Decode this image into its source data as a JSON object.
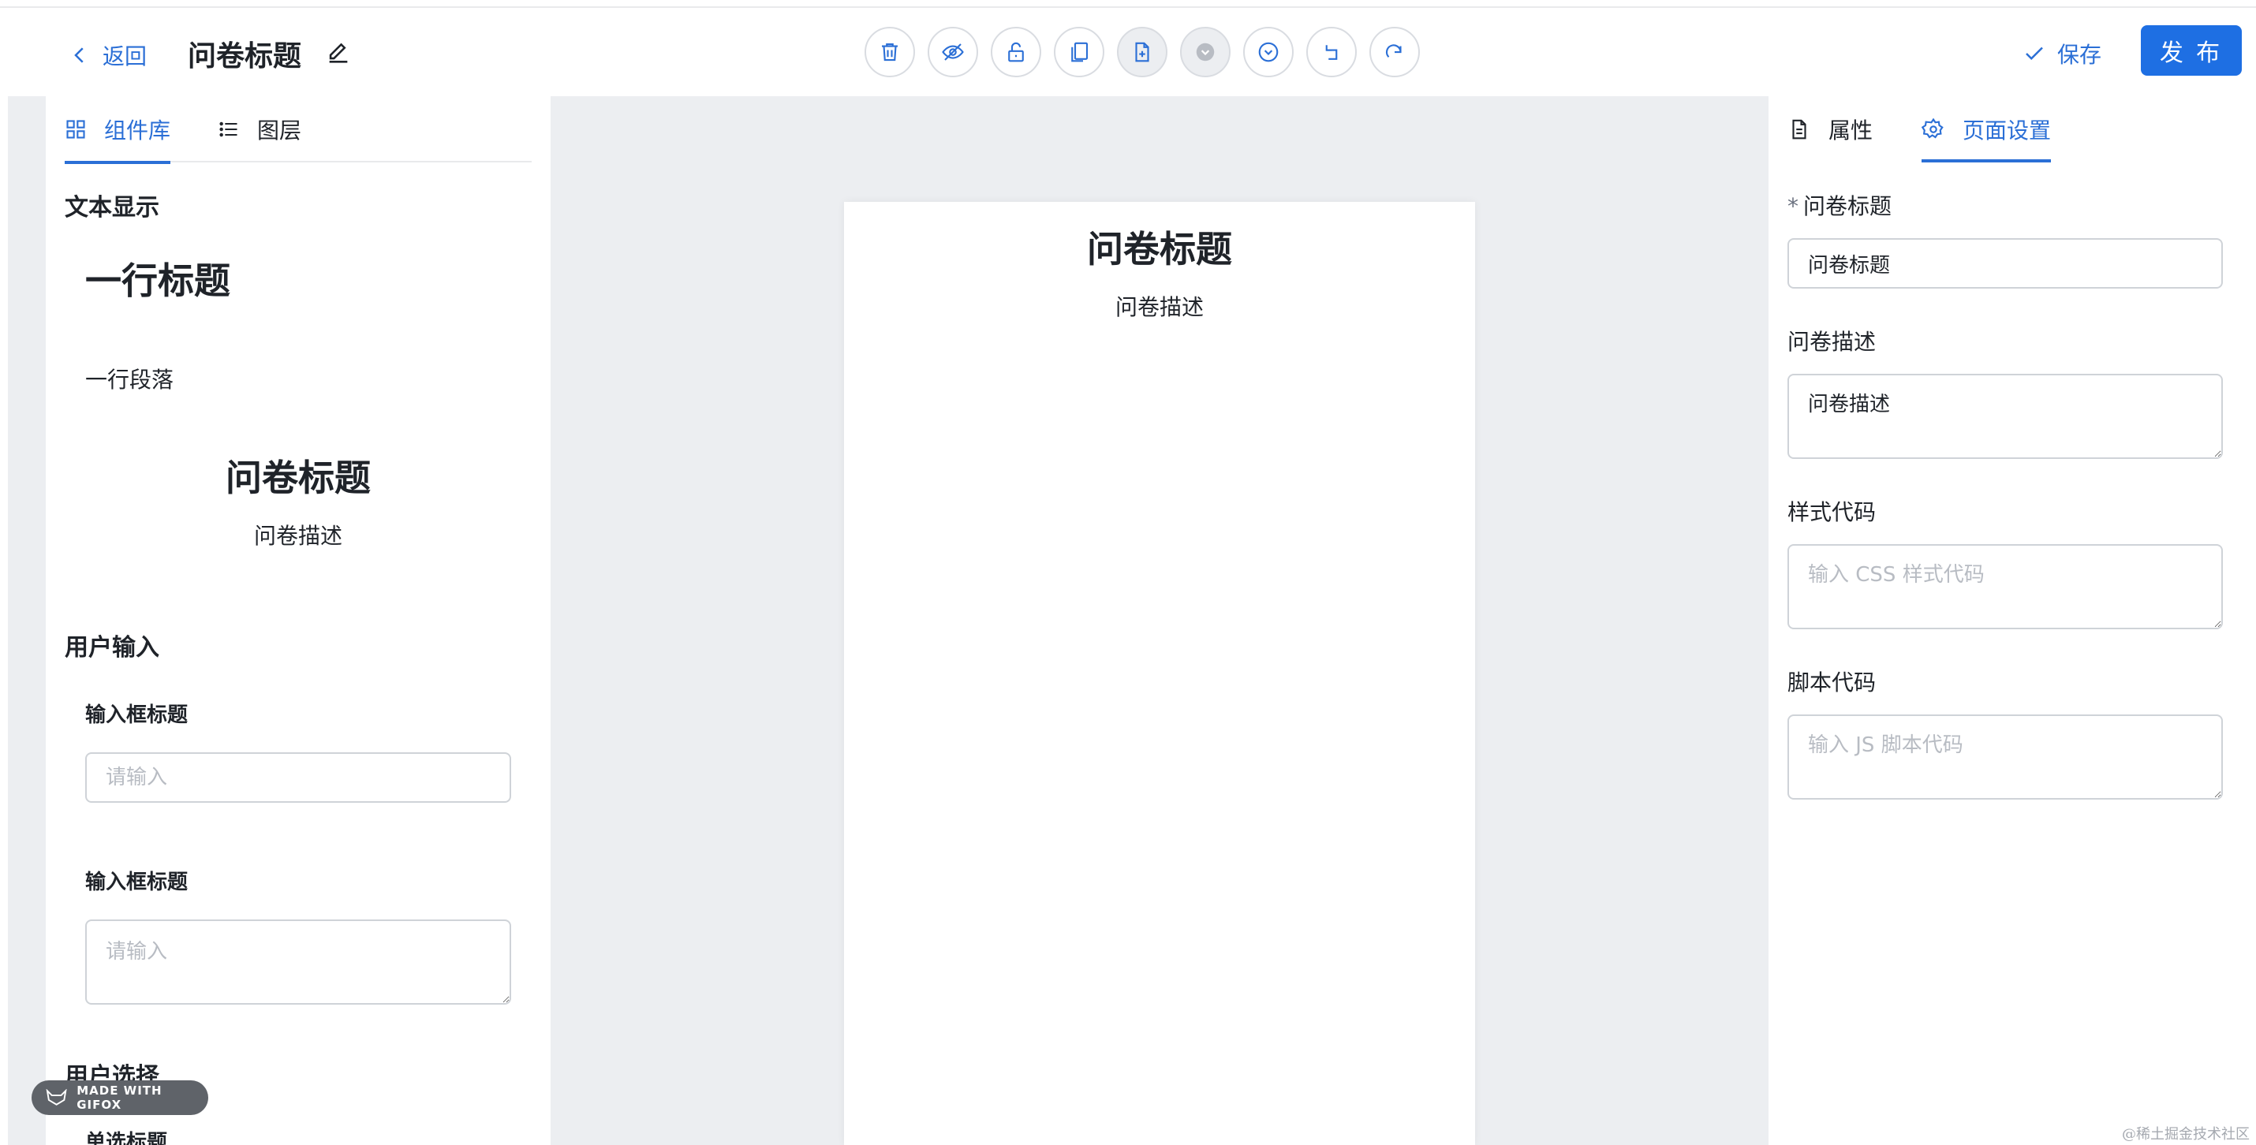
{
  "header": {
    "back_label": "返回",
    "title": "问卷标题",
    "save_label": "保存",
    "publish_label": "发 布",
    "toolbar_icons": [
      "delete-icon",
      "hide-icon",
      "unlock-icon",
      "copy-icon",
      "paste-icon",
      "move-up-icon",
      "move-down-icon",
      "undo-icon",
      "redo-icon"
    ]
  },
  "left": {
    "tabs": [
      {
        "label": "组件库",
        "icon": "grid-icon",
        "active": true
      },
      {
        "label": "图层",
        "icon": "list-icon",
        "active": false
      }
    ],
    "sections": {
      "text_display": "文本显示",
      "user_input": "用户输入",
      "user_choice": "用户选择"
    },
    "components": {
      "heading": "一行标题",
      "paragraph": "一行段落",
      "question_title": "问卷标题",
      "question_desc": "问卷描述",
      "input_label_1": "输入框标题",
      "input_placeholder_1": "请输入",
      "input_label_2": "输入框标题",
      "textarea_placeholder_2": "请输入",
      "radio_label": "单选标题"
    }
  },
  "canvas": {
    "title": "问卷标题",
    "description": "问卷描述"
  },
  "right": {
    "tabs": [
      {
        "label": "属性",
        "icon": "file-icon",
        "active": false
      },
      {
        "label": "页面设置",
        "icon": "gear-icon",
        "active": true
      }
    ],
    "fields": {
      "title_label": "问卷标题",
      "title_required": "*",
      "title_value": "问卷标题",
      "desc_label": "问卷描述",
      "desc_value": "问卷描述",
      "css_label": "样式代码",
      "css_placeholder": "输入 CSS 样式代码",
      "js_label": "脚本代码",
      "js_placeholder": "输入 JS 脚本代码"
    }
  },
  "overlay": {
    "gifox": "MADE WITH GIFOX",
    "watermark": "@稀土掘金技术社区"
  },
  "colors": {
    "accent": "#2b6fd6",
    "primary_button": "#1e6fe3",
    "canvas_bg": "#eceef1"
  }
}
